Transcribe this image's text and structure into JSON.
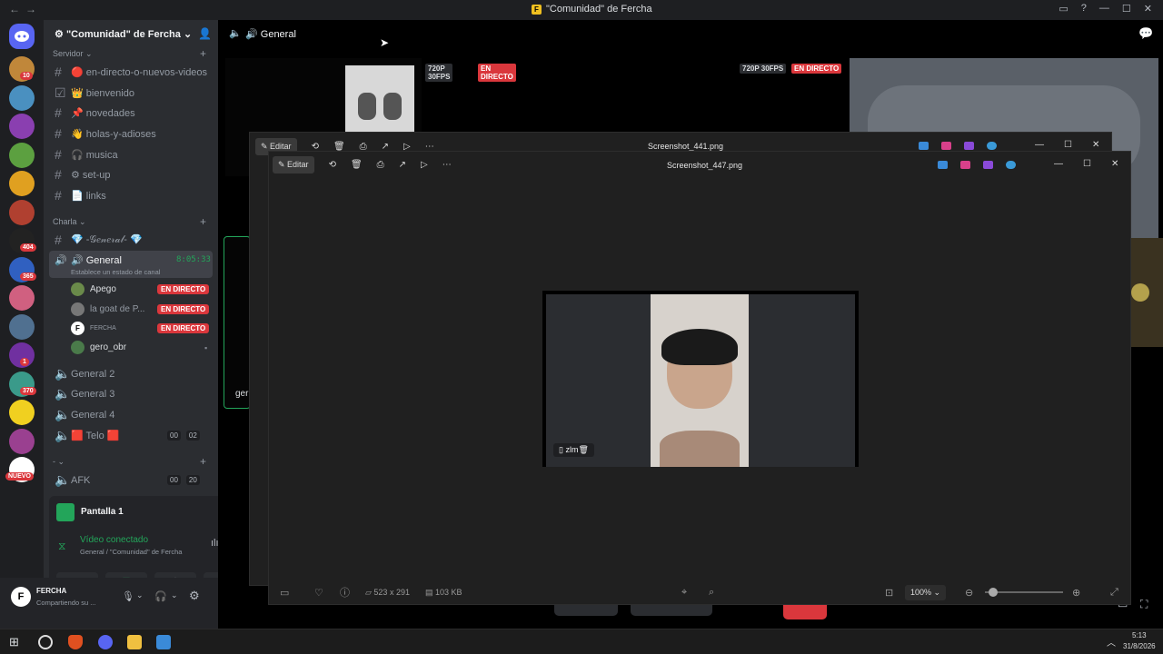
{
  "titlebar": {
    "title": "\"Comunidad\" de Fercha",
    "back": "←",
    "forward": "→"
  },
  "rail": {
    "servers": [
      {
        "badge": "10",
        "color": "#c0873a"
      },
      {
        "badge": "",
        "color": "#4a90c0"
      },
      {
        "badge": "",
        "color": "#8a3fb0"
      },
      {
        "badge": "",
        "color": "#5ca040"
      },
      {
        "badge": "",
        "color": "#e0a020"
      },
      {
        "badge": "",
        "color": "#b04030"
      },
      {
        "badge": "404",
        "color": "#222222"
      },
      {
        "badge": "365",
        "color": "#3060c0"
      },
      {
        "badge": "",
        "color": "#d06080"
      },
      {
        "badge": "",
        "color": "#507090"
      },
      {
        "badge": "1",
        "color": "#7030a0"
      },
      {
        "badge": "370",
        "color": "#3a9a8a"
      },
      {
        "badge": "",
        "color": "#f0d020"
      },
      {
        "badge": "",
        "color": "#9a4090"
      },
      {
        "badge": "NUEVO",
        "color": "#ffffff"
      }
    ]
  },
  "sidebar": {
    "server_name": "\"Comunidad\" de Fercha",
    "categories": {
      "server": "Servidor",
      "talk": "Charla",
      "dash": "-"
    },
    "channels": [
      {
        "label": "🔴 en-directo-o-nuevos-videos",
        "icon": "hash-icon"
      },
      {
        "label": "👑 bienvenido",
        "icon": "rules-icon"
      },
      {
        "label": "📌 novedades",
        "icon": "hash-icon"
      },
      {
        "label": "👋 holas-y-adioses",
        "icon": "hash-icon"
      },
      {
        "label": "🎧 musica",
        "icon": "hash-icon"
      },
      {
        "label": "⚙ set-up",
        "icon": "hash-icon"
      },
      {
        "label": "📄 links",
        "icon": "hash-icon"
      }
    ],
    "talk_text": "💎 -𝒢𝑒𝓃𝑒𝓇𝒶𝓁- 💎",
    "voice_active": {
      "label": "🔊 General",
      "timer": "8:05:33",
      "status": "Establece un estado de canal"
    },
    "voice_users": [
      {
        "name": "Apego",
        "live": "EN DIRECTO"
      },
      {
        "name": "la goat de P...",
        "live": "EN DIRECTO"
      },
      {
        "name": "FERCHA",
        "live": "EN DIRECTO"
      },
      {
        "name": "gero_obr",
        "live": ""
      }
    ],
    "voice_channels": [
      "General 2",
      "General 3",
      "General 4"
    ],
    "telo": {
      "label": "🟥 Telo 🟥",
      "c1": "00",
      "c2": "02"
    },
    "afk": {
      "label": "AFK",
      "c1": "00",
      "c2": "20"
    }
  },
  "screen_panel": {
    "title": "Pantalla 1",
    "status": "Vídeo conectado",
    "location": "General / \"Comunidad\" de Fercha"
  },
  "user_panel": {
    "name": "FERCHA",
    "status": "Compartiendo su ..."
  },
  "main": {
    "channel": "General",
    "tiles": [
      {
        "quality": "720P 30FPS",
        "live": "EN DIRECTO"
      },
      {
        "quality": "720P 30FPS",
        "live": "EN DIRECTO"
      }
    ],
    "ger_label": "ger"
  },
  "viewer_back": {
    "edit": "Editar",
    "filename": "Screenshot_441.png"
  },
  "viewer_front": {
    "edit": "Editar",
    "filename": "Screenshot_447.png",
    "caption": "zlm🗑",
    "dimensions": "523 x 291",
    "size": "103 KB",
    "zoom": "100%",
    "zoom_fraction": 0.1
  },
  "taskbar": {
    "time": "5:13",
    "date": "31/8/2026"
  },
  "colors": {
    "live": "#da373c",
    "sidebar": "#2b2d31",
    "rail": "#1e1f22",
    "green": "#23a55a"
  }
}
